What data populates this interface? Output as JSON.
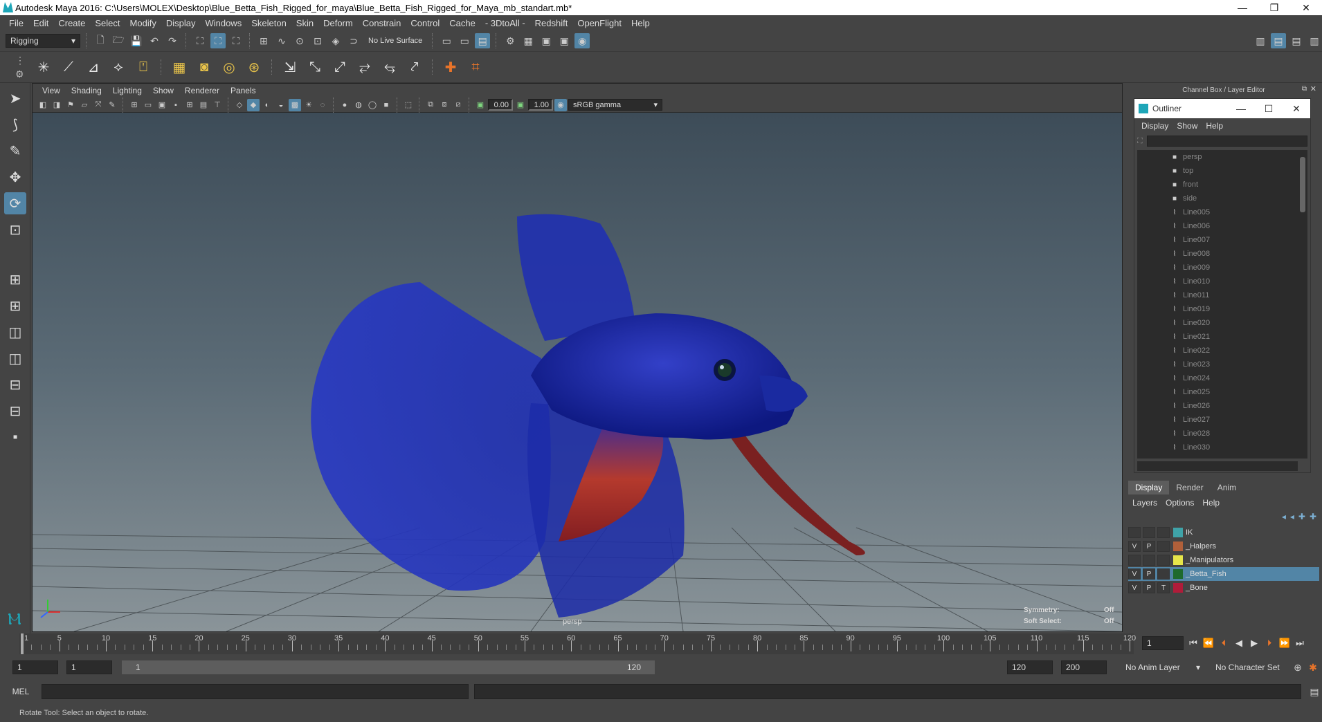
{
  "window": {
    "title": "Autodesk Maya 2016: C:\\Users\\MOLEX\\Desktop\\Blue_Betta_Fish_Rigged_for_maya\\Blue_Betta_Fish_Rigged_for_Maya_mb_standart.mb*",
    "minimize": "—",
    "restore": "❐",
    "close": "✕"
  },
  "menubar": [
    "File",
    "Edit",
    "Create",
    "Select",
    "Modify",
    "Display",
    "Windows",
    "Skeleton",
    "Skin",
    "Deform",
    "Constrain",
    "Control",
    "Cache",
    "- 3DtoAll -",
    "Redshift",
    "OpenFlight",
    "Help"
  ],
  "statusline": {
    "menuset": "Rigging",
    "live_surface": "No Live Surface"
  },
  "viewport": {
    "menu": [
      "View",
      "Shading",
      "Lighting",
      "Show",
      "Renderer",
      "Panels"
    ],
    "exposure": "0.00",
    "gamma": "1.00",
    "colorspace": "sRGB gamma",
    "camera_label": "persp",
    "symmetry_label": "Symmetry:",
    "symmetry_value": "Off",
    "softselect_label": "Soft Select:",
    "softselect_value": "Off"
  },
  "channelbox": {
    "header": "Channel Box / Layer Editor"
  },
  "outliner": {
    "title": "Outliner",
    "menu": [
      "Display",
      "Show",
      "Help"
    ],
    "items": [
      {
        "name": "persp",
        "icon": "camera-icon"
      },
      {
        "name": "top",
        "icon": "camera-icon"
      },
      {
        "name": "front",
        "icon": "camera-icon"
      },
      {
        "name": "side",
        "icon": "camera-icon"
      },
      {
        "name": "Line005",
        "icon": "curve-icon"
      },
      {
        "name": "Line006",
        "icon": "curve-icon"
      },
      {
        "name": "Line007",
        "icon": "curve-icon"
      },
      {
        "name": "Line008",
        "icon": "curve-icon"
      },
      {
        "name": "Line009",
        "icon": "curve-icon"
      },
      {
        "name": "Line010",
        "icon": "curve-icon"
      },
      {
        "name": "Line011",
        "icon": "curve-icon"
      },
      {
        "name": "Line019",
        "icon": "curve-icon"
      },
      {
        "name": "Line020",
        "icon": "curve-icon"
      },
      {
        "name": "Line021",
        "icon": "curve-icon"
      },
      {
        "name": "Line022",
        "icon": "curve-icon"
      },
      {
        "name": "Line023",
        "icon": "curve-icon"
      },
      {
        "name": "Line024",
        "icon": "curve-icon"
      },
      {
        "name": "Line025",
        "icon": "curve-icon"
      },
      {
        "name": "Line026",
        "icon": "curve-icon"
      },
      {
        "name": "Line027",
        "icon": "curve-icon"
      },
      {
        "name": "Line028",
        "icon": "curve-icon"
      },
      {
        "name": "Line030",
        "icon": "curve-icon"
      }
    ]
  },
  "layer_editor": {
    "tabs": [
      "Display",
      "Render",
      "Anim"
    ],
    "menu": [
      "Layers",
      "Options",
      "Help"
    ],
    "layers": [
      {
        "name": "IK",
        "v": "",
        "p": "",
        "t": "",
        "color": "#3fa3a8",
        "selected": false
      },
      {
        "name": "_Halpers",
        "v": "V",
        "p": "P",
        "t": "",
        "color": "#b0603a",
        "selected": false
      },
      {
        "name": "_Manipulators",
        "v": "",
        "p": "",
        "t": "",
        "color": "#e6e64a",
        "selected": false
      },
      {
        "name": "_Betta_Fish",
        "v": "V",
        "p": "P",
        "t": "",
        "color": "#1e6a2e",
        "selected": true
      },
      {
        "name": "_Bone",
        "v": "V",
        "p": "P",
        "t": "T",
        "color": "#b01c3a",
        "selected": false
      }
    ]
  },
  "timeline": {
    "labels": [
      "1",
      "5",
      "10",
      "15",
      "20",
      "25",
      "30",
      "35",
      "40",
      "45",
      "50",
      "55",
      "60",
      "65",
      "70",
      "75",
      "80",
      "85",
      "90",
      "95",
      "100",
      "105",
      "110",
      "115",
      "120"
    ],
    "current_frame": "1"
  },
  "range": {
    "start": "1",
    "anim_start": "1",
    "slider_start": "1",
    "slider_end": "120",
    "anim_end": "120",
    "end": "200",
    "anim_layer": "No Anim Layer",
    "char_set": "No Character Set"
  },
  "cmdline": {
    "mel": "MEL"
  },
  "helpline": {
    "text": "Rotate Tool: Select an object to rotate."
  },
  "colors": {
    "accent": "#5285a6",
    "panel": "#444444",
    "field": "#2b2b2b"
  }
}
